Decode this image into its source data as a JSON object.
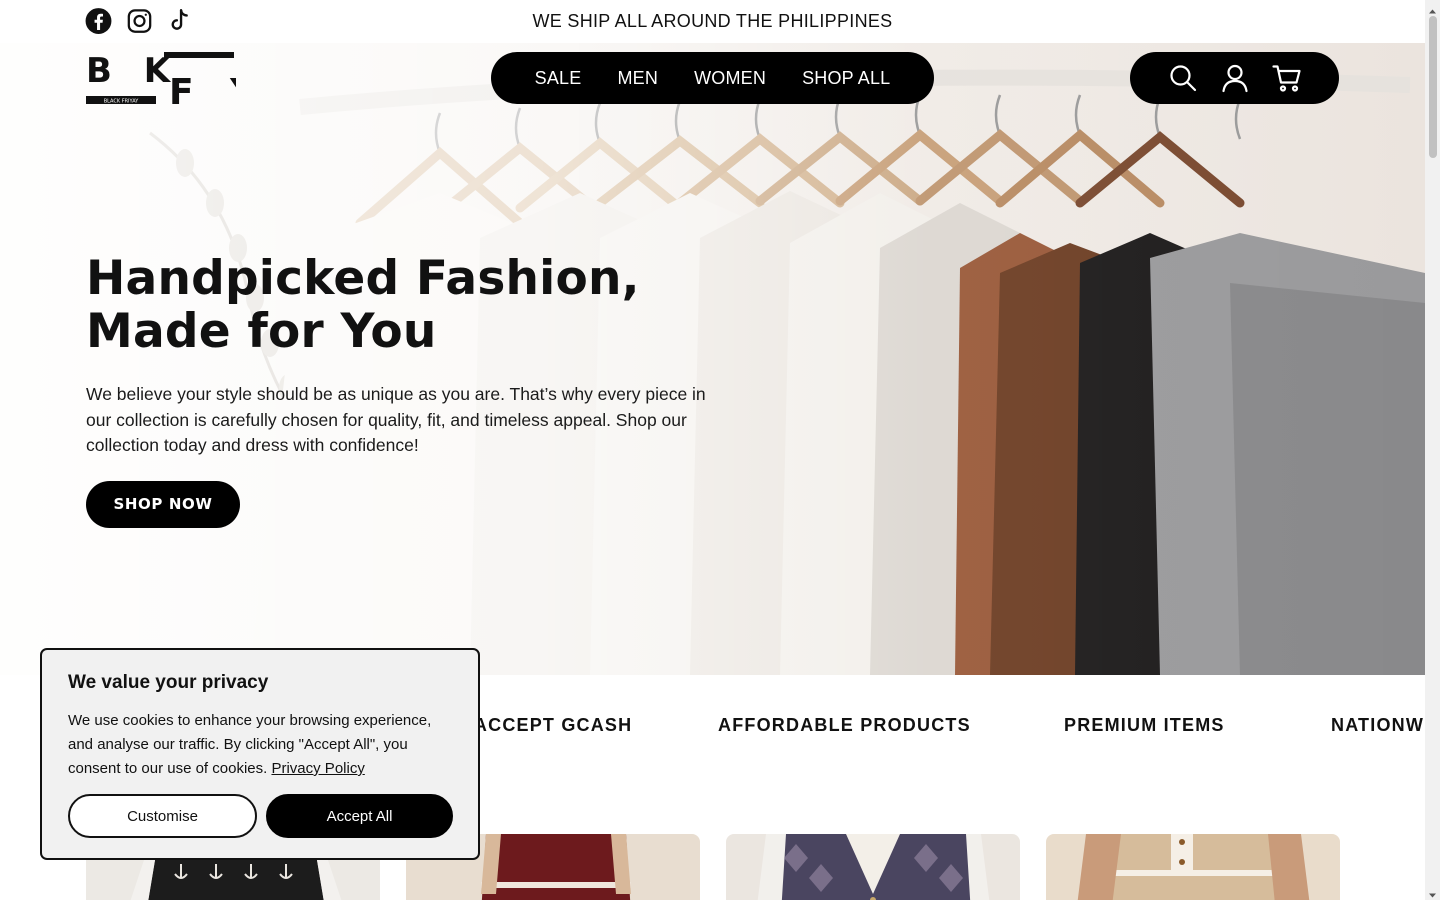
{
  "announcement": "WE SHIP ALL AROUND THE PHILIPPINES",
  "social": [
    {
      "icon": "facebook-icon"
    },
    {
      "icon": "instagram-icon"
    },
    {
      "icon": "tiktok-icon"
    }
  ],
  "brand": {
    "letters_top": "B K",
    "letters_bottom": "F Y",
    "tagline": "BLACK FRIYAY"
  },
  "nav": {
    "items": [
      "SALE",
      "MEN",
      "WOMEN",
      "SHOP ALL"
    ]
  },
  "utility_icons": [
    "search-icon",
    "account-icon",
    "cart-icon"
  ],
  "hero": {
    "title_line1": "Handpicked Fashion,",
    "title_line2": "Made for You",
    "body": "We believe your style should be as unique as you are. That’s why every piece in our collection is carefully chosen for quality, fit, and timeless appeal. Shop our collection today and dress with confidence!",
    "cta": "SHOP NOW"
  },
  "marquee": {
    "items": [
      "WE ACCEPT GCASH",
      "AFFORDABLE PRODUCTS",
      "PREMIUM ITEMS",
      "NATIONWIDE SHIPPING"
    ]
  },
  "cookie": {
    "title": "We value your privacy",
    "body": "We use cookies to enhance your browsing experience, and analyse our traffic. By clicking \"Accept All\", you consent to our use of cookies.",
    "link": "Privacy Policy",
    "customise": "Customise",
    "accept": "Accept All"
  },
  "colors": {
    "primary": "#000000",
    "background": "#ffffff",
    "banner_bg": "#f1f1f1"
  }
}
